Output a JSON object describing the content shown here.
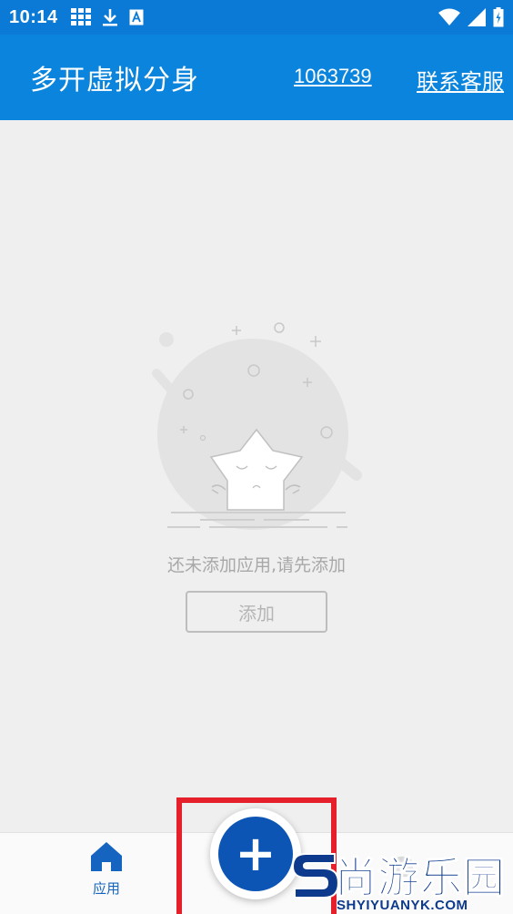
{
  "status_bar": {
    "time": "10:14",
    "icons_left": [
      "grid-icon",
      "download-icon",
      "a-badge-icon"
    ],
    "icons_right": [
      "wifi-icon",
      "signal-icon",
      "battery-icon"
    ]
  },
  "app_bar": {
    "title": "多开虚拟分身",
    "user_id": "1063739",
    "service_link": "联系客服"
  },
  "empty_state": {
    "message": "还未添加应用,请先添加",
    "add_button": "添加"
  },
  "bottom_nav": {
    "apps_label": "应用",
    "fab_icon": "plus-icon"
  },
  "watermark": {
    "brand": "尚游乐园",
    "domain": "SHYIYUANYK.COM"
  },
  "colors": {
    "primary": "#0a84dc",
    "fab": "#0d55b4",
    "highlight": "#e5202a"
  }
}
